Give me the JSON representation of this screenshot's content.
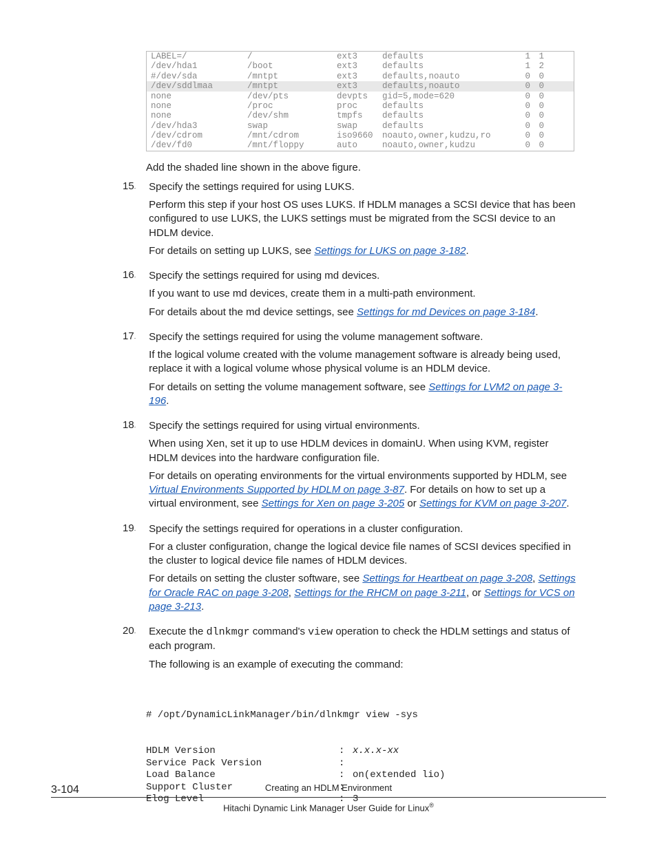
{
  "fstab": {
    "rows": [
      {
        "c0": "LABEL=/",
        "c1": "/",
        "c2": "ext3",
        "c3": "defaults",
        "c4": "1",
        "c5": "1",
        "shaded": false
      },
      {
        "c0": "/dev/hda1",
        "c1": "/boot",
        "c2": "ext3",
        "c3": "defaults",
        "c4": "1",
        "c5": "2",
        "shaded": false
      },
      {
        "c0": "#/dev/sda",
        "c1": "/mntpt",
        "c2": "ext3",
        "c3": "defaults,noauto",
        "c4": "0",
        "c5": "0",
        "shaded": false
      },
      {
        "c0": "/dev/sddlmaa",
        "c1": "/mntpt",
        "c2": "ext3",
        "c3": "defaults,noauto",
        "c4": "0",
        "c5": "0",
        "shaded": true
      },
      {
        "c0": "none",
        "c1": "/dev/pts",
        "c2": "devpts",
        "c3": "gid=5,mode=620",
        "c4": "0",
        "c5": "0",
        "shaded": false
      },
      {
        "c0": "none",
        "c1": "/proc",
        "c2": "proc",
        "c3": "defaults",
        "c4": "0",
        "c5": "0",
        "shaded": false
      },
      {
        "c0": "none",
        "c1": "/dev/shm",
        "c2": "tmpfs",
        "c3": "defaults",
        "c4": "0",
        "c5": "0",
        "shaded": false
      },
      {
        "c0": "/dev/hda3",
        "c1": "swap",
        "c2": "swap",
        "c3": "defaults",
        "c4": "0",
        "c5": "0",
        "shaded": false
      },
      {
        "c0": "/dev/cdrom",
        "c1": "/mnt/cdrom",
        "c2": "iso9660",
        "c3": "noauto,owner,kudzu,ro",
        "c4": "0",
        "c5": "0",
        "shaded": false
      },
      {
        "c0": "/dev/fd0",
        "c1": "/mnt/floppy",
        "c2": "auto",
        "c3": "noauto,owner,kudzu",
        "c4": "0",
        "c5": "0",
        "shaded": false
      }
    ]
  },
  "intro_after_table": "Add the shaded line shown in the above figure.",
  "items": {
    "i15": {
      "num": "15",
      "lead": "Specify the settings required for using LUKS.",
      "p1": "Perform this step if your host OS uses LUKS. If HDLM manages a SCSI device that has been configured to use LUKS, the LUKS settings must be migrated from the SCSI device to an HDLM device.",
      "p2a": "For details on setting up LUKS, see ",
      "link1": "Settings for LUKS on page 3-182",
      "p2b": "."
    },
    "i16": {
      "num": "16",
      "lead": "Specify the settings required for using md devices.",
      "p1": "If you want to use md devices, create them in a multi-path environment.",
      "p2a": "For details about the md device settings, see ",
      "link1": "Settings for md Devices on page 3-184",
      "p2b": "."
    },
    "i17": {
      "num": "17",
      "lead": "Specify the settings required for using the volume management software.",
      "p1": "If the logical volume created with the volume management software is already being used, replace it with a logical volume whose physical volume is an HDLM device.",
      "p2a": "For details on setting the volume management software, see ",
      "link1": "Settings for LVM2 on page 3-196",
      "p2b": "."
    },
    "i18": {
      "num": "18",
      "lead": "Specify the settings required for using virtual environments.",
      "p1": "When using Xen, set it up to use HDLM devices in domainU. When using KVM, register HDLM devices into the hardware configuration file.",
      "p2a": "For details on operating environments for the virtual environments supported by HDLM, see ",
      "link1": "Virtual Environments Supported by HDLM on page 3-87",
      "p2b": ". For details on how to set up a virtual environment, see ",
      "link2": "Settings for Xen on page 3-205",
      "p2c": " or ",
      "link3": "Settings for KVM on page 3-207",
      "p2d": "."
    },
    "i19": {
      "num": "19",
      "lead": "Specify the settings required for operations in a cluster configuration.",
      "p1": "For a cluster configuration, change the logical device file names of SCSI devices specified in the cluster to logical device file names of HDLM devices.",
      "p2a": "For details on setting the cluster software, see ",
      "link1": "Settings for Heartbeat on page 3-208",
      "p2b": ", ",
      "link2": "Settings for Oracle RAC on page 3-208",
      "p2c": ", ",
      "link3": "Settings for the RHCM on page 3-211",
      "p2d": ", or ",
      "link4": "Settings for VCS on page 3-213",
      "p2e": "."
    },
    "i20": {
      "num": "20",
      "lead_a": "Execute the ",
      "lead_cmd1": "dlnkmgr",
      "lead_b": " command's ",
      "lead_cmd2": "view",
      "lead_c": " operation to check the HDLM settings and status of each program.",
      "p1": "The following is an example of executing the command:"
    }
  },
  "cmd": {
    "line0": "# /opt/DynamicLinkManager/bin/dlnkmgr view -sys",
    "rows": [
      {
        "label": "HDLM Version",
        "val": "x.x.x-xx",
        "italic": true
      },
      {
        "label": "Service Pack Version",
        "val": "",
        "italic": false
      },
      {
        "label": "Load Balance",
        "val": "on(extended lio)",
        "italic": false
      },
      {
        "label": "Support Cluster",
        "val": "",
        "italic": false
      },
      {
        "label": "Elog Level",
        "val": "3",
        "italic": false
      }
    ]
  },
  "footer": {
    "page_num": "3-104",
    "title": "Creating an HDLM Environment",
    "book": "Hitachi Dynamic Link Manager User Guide for Linux",
    "reg": "®"
  }
}
